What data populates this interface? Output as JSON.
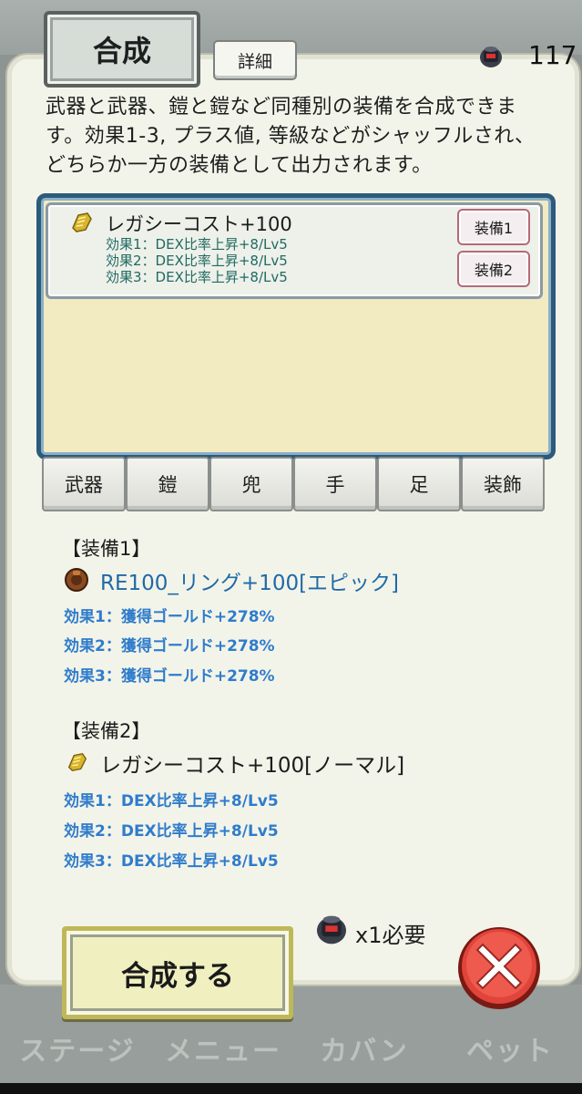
{
  "header": {
    "tab_title": "合成",
    "detail_button": "詳細",
    "stone_count": "117",
    "stone_icon": "magic-stone-icon"
  },
  "description": "武器と武器、鎧と鎧など同種別の装備を合成できます。効果1-3, プラス値, 等級などがシャッフルされ、どちらか一方の装備として出力されます。",
  "list": {
    "items": [
      {
        "icon": "golden-glove-icon",
        "name": "レガシーコスト+100",
        "effects": [
          "効果1：DEX比率上昇+8/Lv5",
          "効果2：DEX比率上昇+8/Lv5",
          "効果3：DEX比率上昇+8/Lv5"
        ],
        "button1": "装備1",
        "button2": "装備2"
      }
    ]
  },
  "categories": [
    "武器",
    "鎧",
    "兜",
    "手",
    "足",
    "装飾"
  ],
  "equip1": {
    "heading": "【装備1】",
    "icon": "brown-ring-icon",
    "name": "RE100_リング+100[エピック]",
    "name_color": "#1f6aa8",
    "effects": [
      "効果1：獲得ゴールド+278%",
      "効果2：獲得ゴールド+278%",
      "効果3：獲得ゴールド+278%"
    ]
  },
  "equip2": {
    "heading": "【装備2】",
    "icon": "golden-glove-icon",
    "name": "レガシーコスト+100[ノーマル]",
    "name_color": "#1c1c1c",
    "effects": [
      "効果1：DEX比率上昇+8/Lv5",
      "効果2：DEX比率上昇+8/Lv5",
      "効果3：DEX比率上昇+8/Lv5"
    ]
  },
  "requirement": "x1必要",
  "craft_button": "合成する",
  "close_icon": "close-x-icon",
  "bottom_nav": [
    "ステージ",
    "メニュー",
    "カバン",
    "ペット"
  ]
}
